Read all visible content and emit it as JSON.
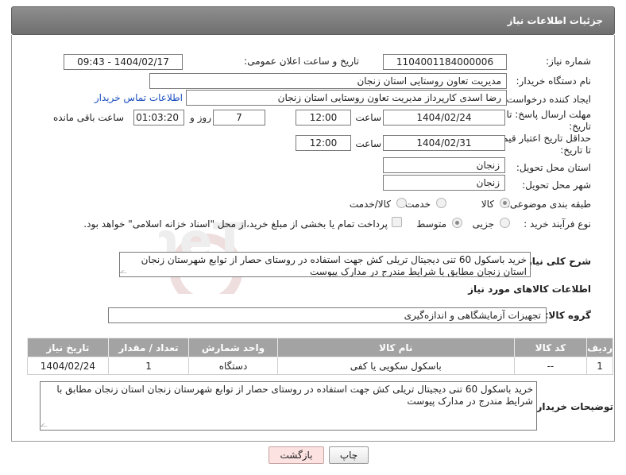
{
  "panel": {
    "title": "جزئیات اطلاعات نیاز"
  },
  "need_number": {
    "label": "شماره نیاز:",
    "value": "1104001184000006"
  },
  "announce": {
    "label": "تاریخ و ساعت اعلان عمومی:",
    "value": "1404/02/17 - 09:43"
  },
  "buyer_org": {
    "label": "نام دستگاه خریدار:",
    "value": "مدیریت تعاون روستایی استان زنجان"
  },
  "creator": {
    "label": "ایجاد کننده درخواست:",
    "value": "رضا اسدی کارپرداز مدیریت تعاون روستایی استان زنجان",
    "contact_link": "اطلاعات تماس خریدار"
  },
  "deadline": {
    "label_line1": "مهلت ارسال پاسخ: تا",
    "label_line2": "تاریخ:",
    "date": "1404/02/24",
    "time_label": "ساعت",
    "time": "12:00",
    "days": "7",
    "days_label": "روز و",
    "remaining": "01:03:20",
    "remaining_label": "ساعت باقی مانده"
  },
  "validity": {
    "label_line1": "حداقل تاریخ اعتبار قیمت:",
    "label_line2": "تا تاریخ:",
    "date": "1404/02/31",
    "time_label": "ساعت",
    "time": "12:00"
  },
  "province": {
    "label": "استان محل تحویل:",
    "value": "زنجان"
  },
  "city": {
    "label": "شهر محل تحویل:",
    "value": "زنجان"
  },
  "category": {
    "label": "طبقه بندی موضوعی:",
    "options": [
      "کالا",
      "خدمت",
      "کالا/خدمت"
    ],
    "selected": "کالا"
  },
  "process": {
    "label": "نوع فرآیند خرید :",
    "options": [
      "جزیی",
      "متوسط"
    ],
    "selected": "متوسط",
    "payment_note": "پرداخت تمام یا بخشی از مبلغ خرید،از محل \"اسناد خزانه اسلامی\" خواهد بود."
  },
  "general_desc": {
    "label": "شرح کلی نیاز:",
    "value": "خرید باسکول 60 تنی دیجیتال تریلی کش جهت استفاده در روستای حصار از توابع شهرستان زنجان استان زنجان مطابق با شرایط مندرج در مدارک پیوست"
  },
  "goods_section": {
    "title": "اطلاعات کالاهای مورد نیاز"
  },
  "goods_group": {
    "label": "گروه کالا:",
    "value": "تجهیزات آزمایشگاهی و اندازه‌گیری"
  },
  "table": {
    "headers": [
      "ردیف",
      "کد کالا",
      "نام کالا",
      "واحد شمارش",
      "تعداد / مقدار",
      "تاریخ نیاز"
    ],
    "rows": [
      [
        "1",
        "--",
        "باسکول سکویی یا کفی",
        "دستگاه",
        "1",
        "1404/02/24"
      ]
    ]
  },
  "buyer_notes": {
    "label": "توضیحات خریدار:",
    "value": "خرید باسکول 60 تنی دیجیتال تریلی کش جهت استفاده در روستای حصار از توابع شهرستان زنجان استان زنجان مطابق با شرایط مندرج در مدارک پیوست"
  },
  "buttons": {
    "print": "چاپ",
    "back": "بازگشت"
  },
  "colors": {
    "header_bg": "#7d7d7d",
    "table_header_bg": "#a3a3a3",
    "link": "#1a4fbf",
    "back_button_bg": "#fde2e2"
  }
}
